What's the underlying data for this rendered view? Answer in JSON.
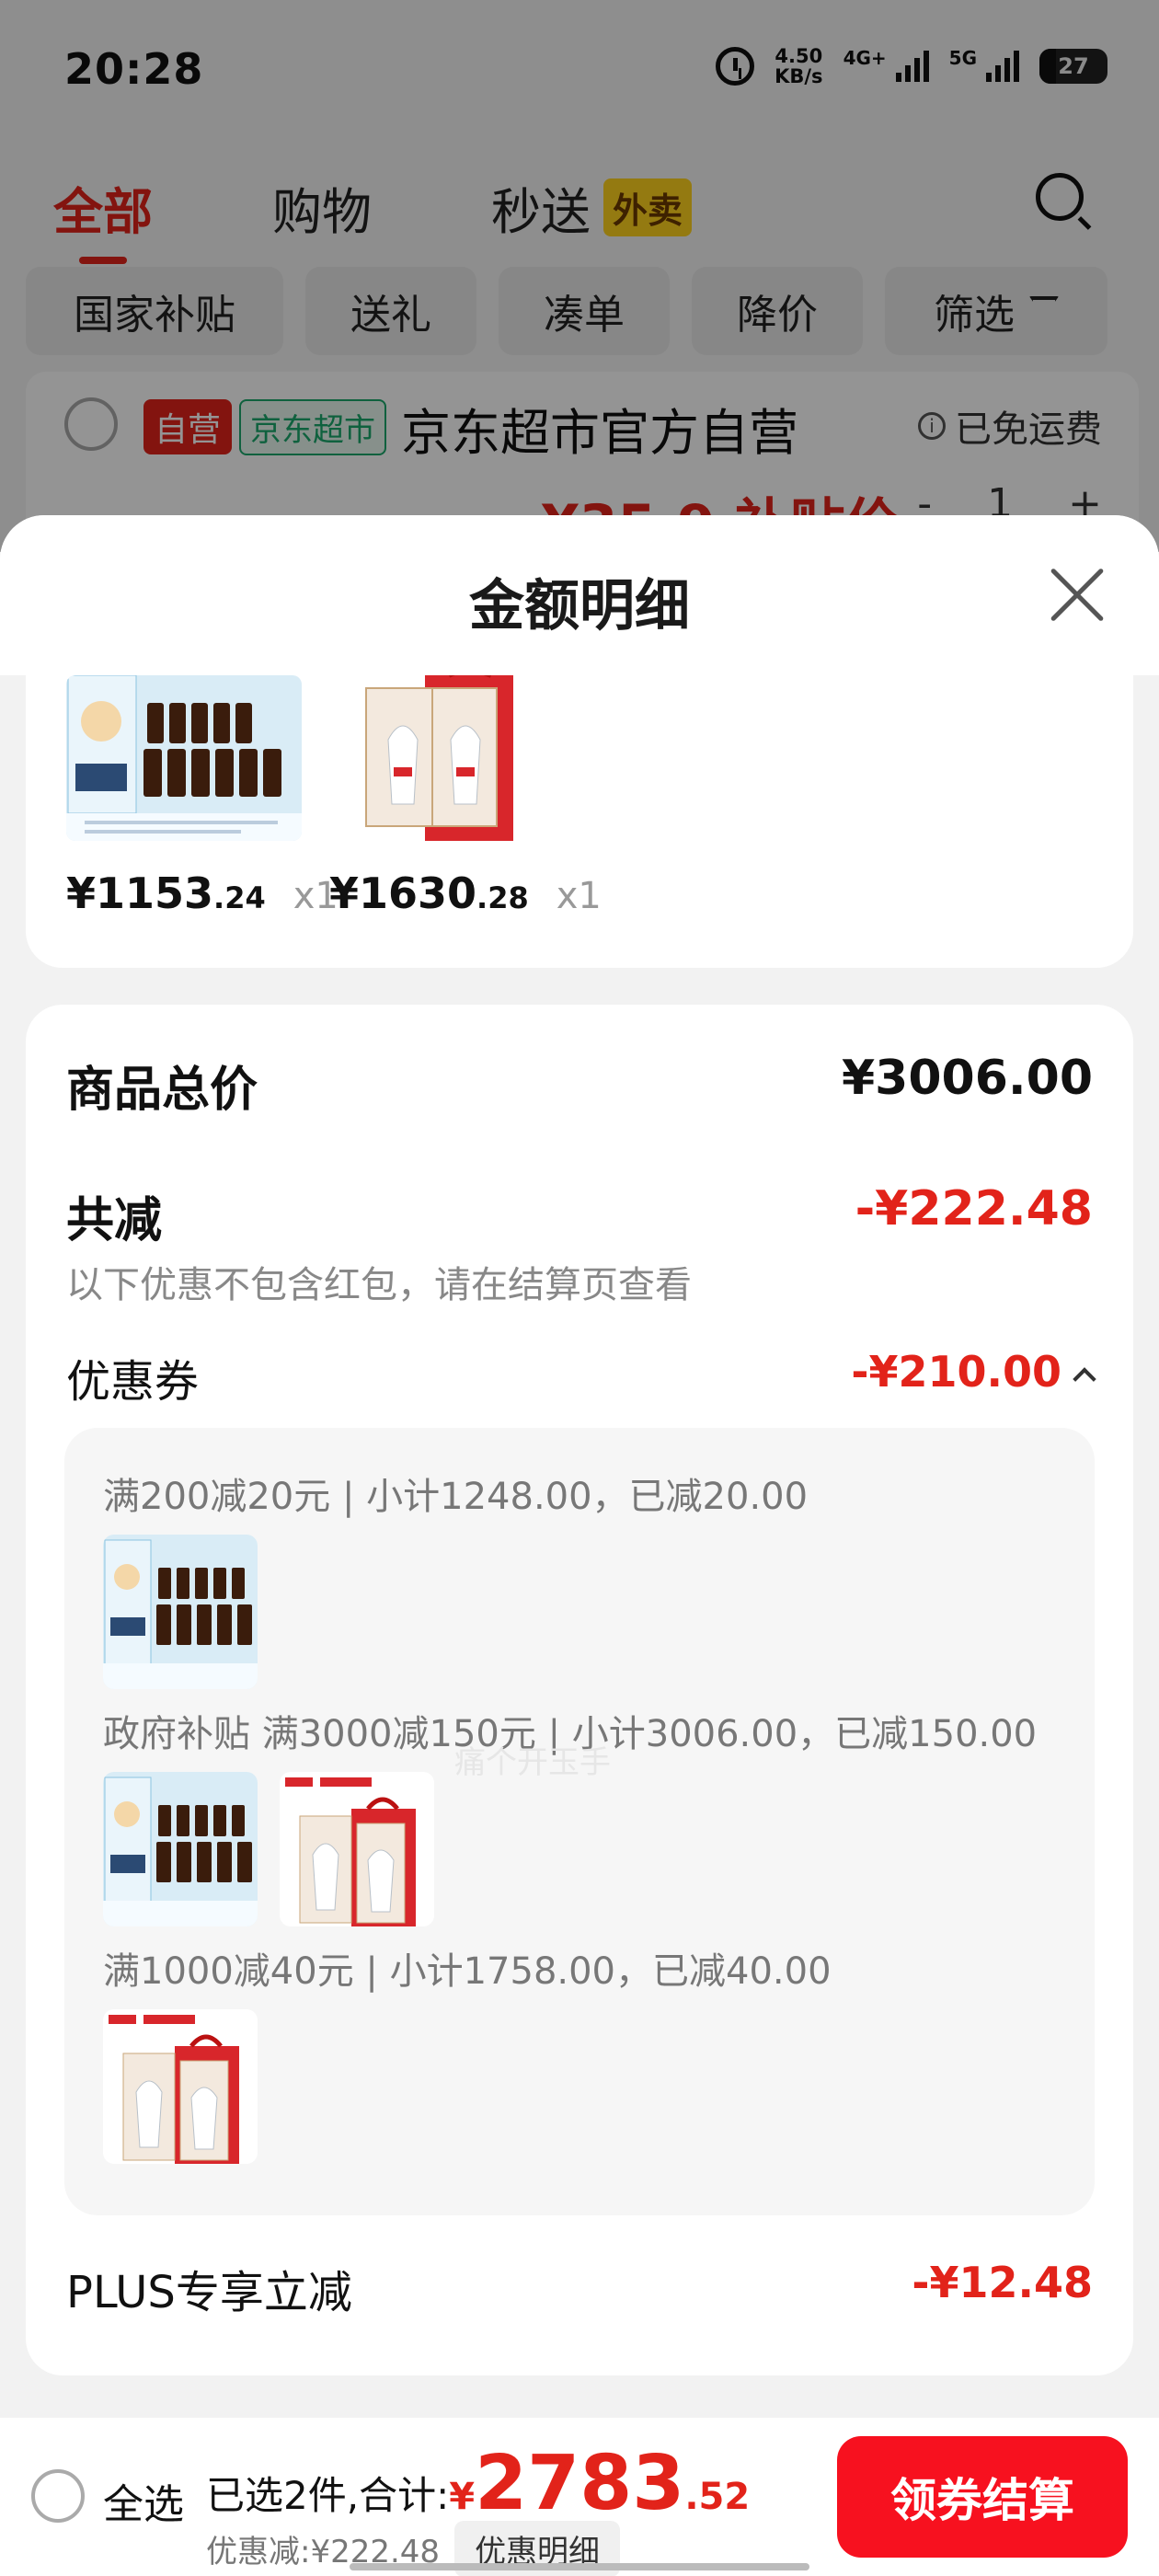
{
  "status_bar": {
    "time": "20:28",
    "speed_value": "4.50",
    "speed_unit": "KB/s",
    "net1": "4G+",
    "net2": "5G",
    "battery": "27"
  },
  "top_tabs": [
    {
      "label": "全部"
    },
    {
      "label": "购物"
    },
    {
      "label": "秒送",
      "badge": "外卖"
    }
  ],
  "filter_chips": [
    "国家补贴",
    "送礼",
    "凑单",
    "降价",
    "筛选"
  ],
  "shop": {
    "badge_self": "自营",
    "badge_market": "京东超市",
    "name": "京东超市官方自营",
    "shipping": "已免运费",
    "price_partial": "¥35.9 补贴价",
    "qty_minus": "-",
    "qty": "1",
    "qty_plus": "+"
  },
  "sheet": {
    "title": "金额明细",
    "products": [
      {
        "price_int": "¥1153",
        "price_dec": ".24",
        "qty": "x1"
      },
      {
        "price_int": "¥1630",
        "price_dec": ".28",
        "qty": "x1"
      }
    ],
    "total": {
      "label": "商品总价",
      "value": "¥3006.00"
    },
    "reduce": {
      "label": "共减",
      "value": "-¥222.48",
      "note": "以下优惠不包含红包，请在结算页查看"
    },
    "coupon": {
      "label": "优惠券",
      "value": "-¥210.00",
      "lines": [
        "满200减20元 | 小计1248.00，已减20.00",
        "政府补贴 满3000减150元 | 小计3006.00，已减150.00",
        "满1000减40元 | 小计1758.00，已减40.00"
      ]
    },
    "plus": {
      "label": "PLUS专享立减",
      "value": "-¥12.48"
    },
    "watermark": "痛个开玉手"
  },
  "bottom": {
    "select_all": "全选",
    "summary": "已选2件,合计:",
    "currency": "¥",
    "total_int": "2783",
    "total_dec": ".52",
    "discount": "优惠减:¥222.48",
    "detail_button": "优惠明细",
    "checkout": "领券结算"
  },
  "colors": {
    "accent": "#e2231a",
    "checkout": "#f7111f"
  }
}
